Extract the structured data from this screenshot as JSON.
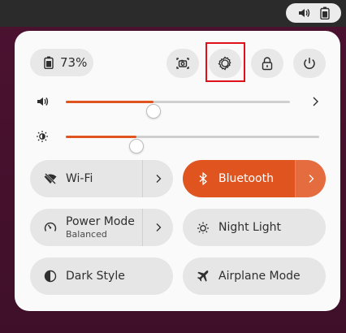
{
  "topbar": {
    "icons": [
      "volume-icon",
      "battery-icon"
    ]
  },
  "quick_settings": {
    "battery": {
      "percent": "73%",
      "icon": "battery-icon"
    },
    "actions": [
      {
        "id": "screenshot",
        "icon": "screenshot-icon"
      },
      {
        "id": "settings",
        "icon": "settings-icon",
        "highlighted": true
      },
      {
        "id": "lock",
        "icon": "lock-icon"
      },
      {
        "id": "power",
        "icon": "power-icon"
      }
    ],
    "sliders": [
      {
        "id": "volume",
        "icon": "volume-icon",
        "value": 0.39
      },
      {
        "id": "brightness",
        "icon": "brightness-icon",
        "value": 0.28
      }
    ],
    "toggles": [
      {
        "id": "wifi",
        "label": "Wi-Fi",
        "icon": "wifi-off-icon",
        "active": false,
        "has_menu": true
      },
      {
        "id": "bluetooth",
        "label": "Bluetooth",
        "icon": "bluetooth-icon",
        "active": true,
        "has_menu": true
      },
      {
        "id": "power-mode",
        "label": "Power Mode",
        "sublabel": "Balanced",
        "icon": "power-mode-icon",
        "active": false,
        "has_menu": true
      },
      {
        "id": "night-light",
        "label": "Night Light",
        "icon": "night-light-icon",
        "active": false,
        "has_menu": false
      },
      {
        "id": "dark-style",
        "label": "Dark Style",
        "icon": "dark-style-icon",
        "active": false,
        "has_menu": false
      },
      {
        "id": "airplane-mode",
        "label": "Airplane Mode",
        "icon": "airplane-icon",
        "active": false,
        "has_menu": false
      }
    ]
  },
  "colors": {
    "accent": "#e0541f",
    "panel": "#fafafa",
    "tile": "#e6e6e6",
    "highlight": "#e0101a"
  }
}
